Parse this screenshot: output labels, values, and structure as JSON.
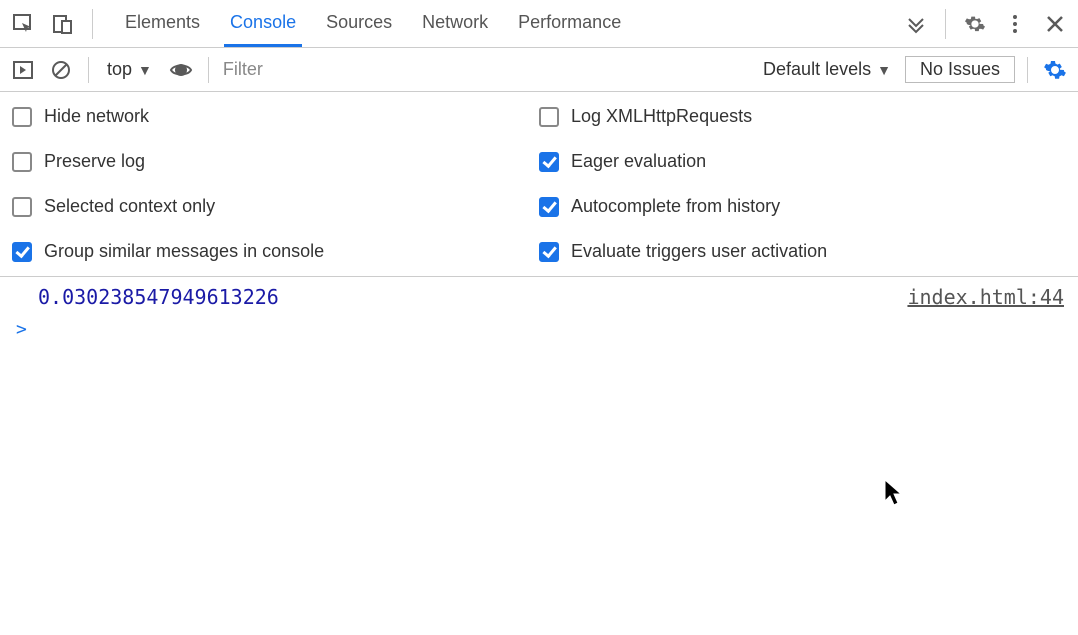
{
  "tabs": {
    "elements": "Elements",
    "console": "Console",
    "sources": "Sources",
    "network": "Network",
    "performance": "Performance"
  },
  "toolbar": {
    "context": "top",
    "filter_placeholder": "Filter",
    "levels": "Default levels",
    "no_issues": "No Issues"
  },
  "settings": {
    "left": [
      {
        "label": "Hide network",
        "checked": false
      },
      {
        "label": "Preserve log",
        "checked": false
      },
      {
        "label": "Selected context only",
        "checked": false
      },
      {
        "label": "Group similar messages in console",
        "checked": true
      }
    ],
    "right": [
      {
        "label": "Log XMLHttpRequests",
        "checked": false
      },
      {
        "label": "Eager evaluation",
        "checked": true
      },
      {
        "label": "Autocomplete from history",
        "checked": true
      },
      {
        "label": "Evaluate triggers user activation",
        "checked": true
      }
    ]
  },
  "console": {
    "log_value": "0.030238547949613226",
    "source": "index.html:44",
    "prompt": ">"
  }
}
